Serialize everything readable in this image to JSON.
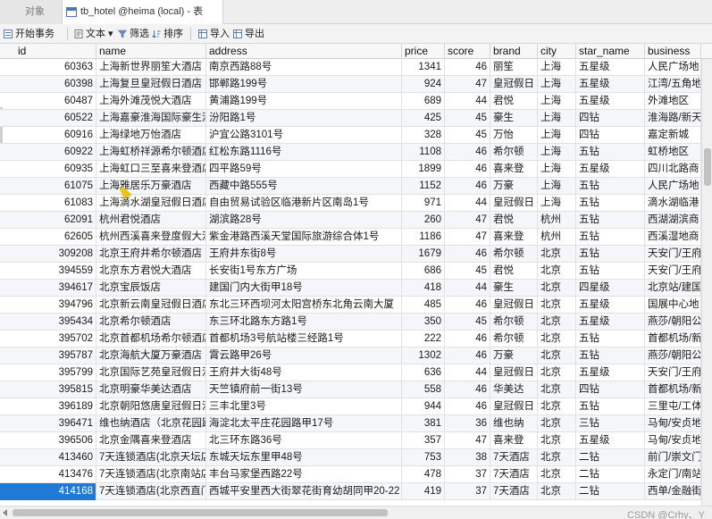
{
  "tabs": {
    "objects_label": "对象",
    "active_label": "tb_hotel @heima (local) - 表"
  },
  "toolbar": {
    "begin_transaction": "开始事务",
    "text": "文本 ▾",
    "filter": "筛选",
    "sort": "排序",
    "import": "导入",
    "export": "导出"
  },
  "columns": [
    "id",
    "name",
    "address",
    "price",
    "score",
    "brand",
    "city",
    "star_name",
    "business"
  ],
  "rows": [
    [
      "60363",
      "上海新世界丽笙大酒店",
      "南京西路88号",
      "1341",
      "46",
      "丽笙",
      "上海",
      "五星级",
      "人民广场地"
    ],
    [
      "60398",
      "上海复旦皇冠假日酒店",
      "邯郸路199号",
      "924",
      "47",
      "皇冠假日",
      "上海",
      "五星级",
      "江湾/五角地"
    ],
    [
      "60487",
      "上海外滩茂悦大酒店",
      "黄浦路199号",
      "689",
      "44",
      "君悦",
      "上海",
      "五星级",
      "外滩地区"
    ],
    [
      "60522",
      "上海嘉豪淮海国际豪生酒",
      "汾阳路1号",
      "425",
      "45",
      "豪生",
      "上海",
      "四钻",
      "淮海路/新天"
    ],
    [
      "60916",
      "上海绿地万怡酒店",
      "沪宜公路3101号",
      "328",
      "45",
      "万怡",
      "上海",
      "四钻",
      "嘉定新城"
    ],
    [
      "60922",
      "上海虹桥祥源希尔顿酒店",
      "红松东路1116号",
      "1108",
      "46",
      "希尔顿",
      "上海",
      "五钻",
      "虹桥地区"
    ],
    [
      "60935",
      "上海虹口三至喜来登酒店",
      "四平路59号",
      "1899",
      "46",
      "喜来登",
      "上海",
      "五星级",
      "四川北路商"
    ],
    [
      "61075",
      "上海雅居乐万豪酒店",
      "西藏中路555号",
      "1152",
      "46",
      "万豪",
      "上海",
      "五钻",
      "人民广场地"
    ],
    [
      "61083",
      "上海滴水湖皇冠假日酒店",
      "自由贸易试验区临港新片区南岛1号",
      "971",
      "44",
      "皇冠假日",
      "上海",
      "五钻",
      "滴水湖临港"
    ],
    [
      "62091",
      "杭州君悦酒店",
      "湖滨路28号",
      "260",
      "47",
      "君悦",
      "杭州",
      "五钻",
      "西湖湖滨商"
    ],
    [
      "62605",
      "杭州西溪喜来登度假大酒店",
      "紫金港路西溪天堂国际旅游综合体1号",
      "1186",
      "47",
      "喜来登",
      "杭州",
      "五钻",
      "西溪湿地商"
    ],
    [
      "309208",
      "北京王府井希尔顿酒店",
      "王府井东街8号",
      "1679",
      "46",
      "希尔顿",
      "北京",
      "五钻",
      "天安门/王府"
    ],
    [
      "394559",
      "北京东方君悦大酒店",
      "长安街1号东方广场",
      "686",
      "45",
      "君悦",
      "北京",
      "五钻",
      "天安门/王府"
    ],
    [
      "394617",
      "北京宝辰饭店",
      "建国门内大街甲18号",
      "418",
      "44",
      "豪生",
      "北京",
      "四星级",
      "北京站/建国"
    ],
    [
      "394796",
      "北京新云南皇冠假日酒店",
      "东北三环西坝河太阳宫桥东北角云南大厦",
      "485",
      "46",
      "皇冠假日",
      "北京",
      "五星级",
      "国展中心地"
    ],
    [
      "395434",
      "北京希尔顿酒店",
      "东三环北路东方路1号",
      "350",
      "45",
      "希尔顿",
      "北京",
      "五星级",
      "燕莎/朝阳公"
    ],
    [
      "395702",
      "北京首都机场希尔顿酒店",
      "首都机场3号航站楼三经路1号",
      "222",
      "46",
      "希尔顿",
      "北京",
      "五钻",
      "首都机场/新"
    ],
    [
      "395787",
      "北京海航大厦万豪酒店",
      "霄云路甲26号",
      "1302",
      "46",
      "万豪",
      "北京",
      "五钻",
      "燕莎/朝阳公"
    ],
    [
      "395799",
      "北京国际艺苑皇冠假日酒店",
      "王府井大街48号",
      "636",
      "44",
      "皇冠假日",
      "北京",
      "五星级",
      "天安门/王府"
    ],
    [
      "395815",
      "北京明豪华美达酒店",
      "天竺镇府前一街13号",
      "558",
      "46",
      "华美达",
      "北京",
      "四钻",
      "首都机场/新"
    ],
    [
      "396189",
      "北京朝阳悠唐皇冠假日酒店",
      "三丰北里3号",
      "944",
      "46",
      "皇冠假日",
      "北京",
      "五钻",
      "三里屯/工体"
    ],
    [
      "396471",
      "维也纳酒店（北京花园路店）",
      "海淀北太平庄花园路甲17号",
      "381",
      "36",
      "维也纳",
      "北京",
      "三钻",
      "马甸/安贞地"
    ],
    [
      "396506",
      "北京金隅喜来登酒店",
      "北三环东路36号",
      "357",
      "47",
      "喜来登",
      "北京",
      "五星级",
      "马甸/安贞地"
    ],
    [
      "413460",
      "7天连锁酒店(北京天坛店)",
      "东城天坛东里甲48号",
      "753",
      "38",
      "7天酒店",
      "北京",
      "二钻",
      "前门/崇文门"
    ],
    [
      "413476",
      "7天连锁酒店(北京南站店)",
      "丰台马家堡西路22号",
      "478",
      "37",
      "7天酒店",
      "北京",
      "二钻",
      "永定门/南站"
    ],
    [
      "414168",
      "7天连锁酒店(北京西直门店)",
      "西城平安里西大街翠花街育幼胡同甲20-22",
      "419",
      "37",
      "7天酒店",
      "北京",
      "二钻",
      "西单/金融街"
    ]
  ],
  "selected_row_index": 25,
  "watermark": "CSDN @Crhy、Y"
}
